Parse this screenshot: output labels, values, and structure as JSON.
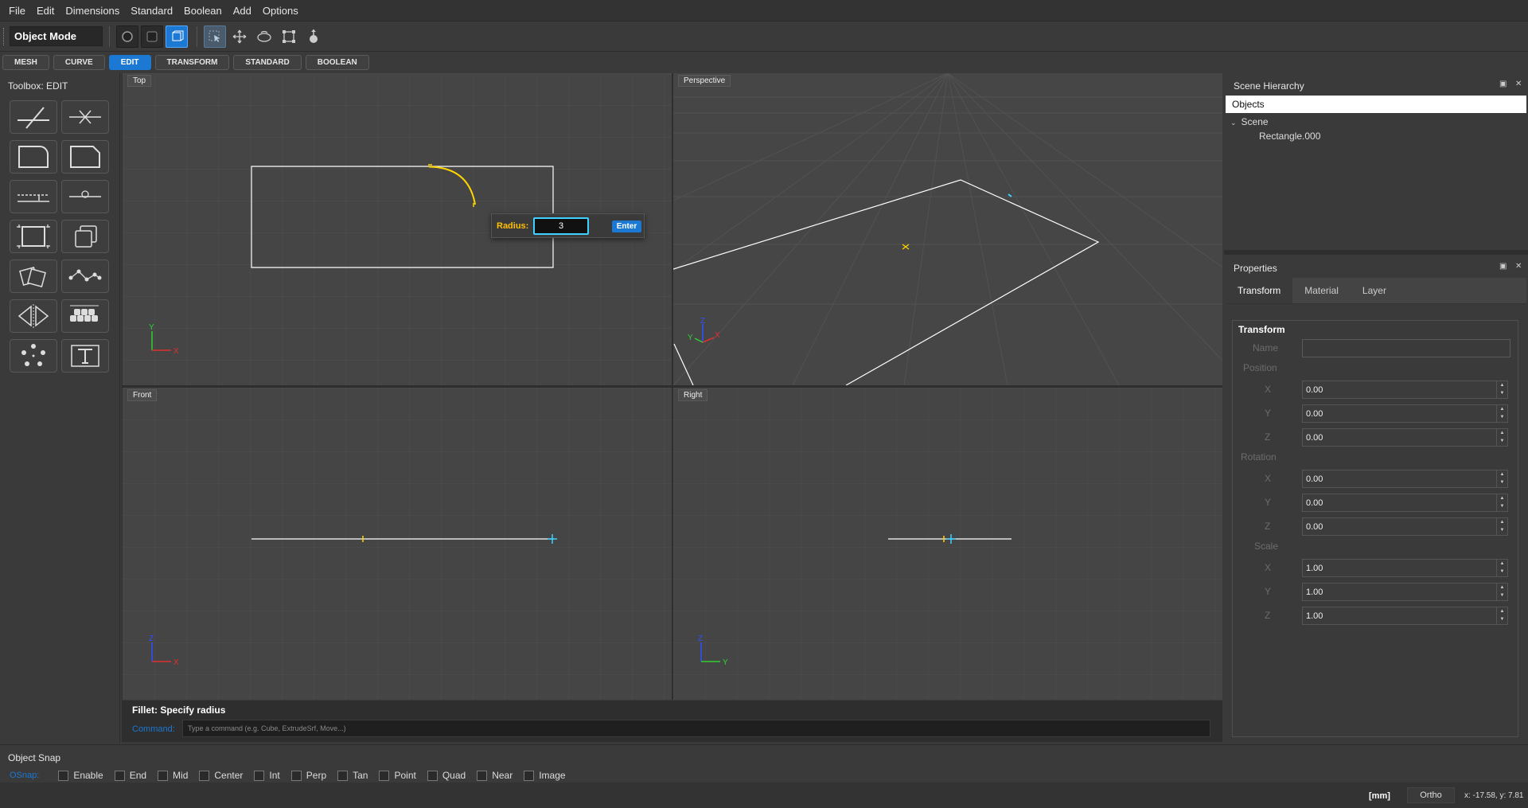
{
  "menu": [
    "File",
    "Edit",
    "Dimensions",
    "Standard",
    "Boolean",
    "Add",
    "Options"
  ],
  "toolbar": {
    "mode": "Object Mode"
  },
  "tabs": [
    "MESH",
    "CURVE",
    "EDIT",
    "TRANSFORM",
    "STANDARD",
    "BOOLEAN"
  ],
  "active_tab": "EDIT",
  "toolbox": {
    "title": "Toolbox: EDIT",
    "tools": [
      "trim",
      "extend",
      "fillet",
      "chamfer",
      "offset",
      "split",
      "bounding-box",
      "copy",
      "rotate-copy",
      "polyline-edit",
      "mirror",
      "array",
      "circular-array",
      "text"
    ]
  },
  "viewports": {
    "top": "Top",
    "perspective": "Perspective",
    "front": "Front",
    "right": "Right"
  },
  "radius_popup": {
    "label": "Radius:",
    "value": "3",
    "button": "Enter"
  },
  "command": {
    "title": "Fillet: Specify radius",
    "label": "Command:",
    "placeholder": "Type a command (e.g. Cube, ExtrudeSrf, Move...)"
  },
  "hierarchy": {
    "title": "Scene Hierarchy",
    "header": "Objects",
    "scene": "Scene",
    "object": "Rectangle.000"
  },
  "properties": {
    "title": "Properties",
    "tabs": [
      "Transform",
      "Material",
      "Layer"
    ],
    "section": "Transform",
    "name_label": "Name",
    "position_label": "Position",
    "rotation_label": "Rotation",
    "scale_label": "Scale",
    "axes": [
      "X",
      "Y",
      "Z"
    ],
    "position": [
      "0.00",
      "0.00",
      "0.00"
    ],
    "rotation": [
      "0.00",
      "0.00",
      "0.00"
    ],
    "scale": [
      "1.00",
      "1.00",
      "1.00"
    ]
  },
  "snap": {
    "title": "Object Snap",
    "label": "OSnap:",
    "options": [
      "Enable",
      "End",
      "Mid",
      "Center",
      "Int",
      "Perp",
      "Tan",
      "Point",
      "Quad",
      "Near",
      "Image"
    ]
  },
  "status": {
    "units": "[mm]",
    "ortho": "Ortho",
    "coords": "x: -17.58, y: 7.81"
  },
  "axis_labels": {
    "x": "X",
    "y": "Y",
    "z": "Z"
  },
  "colors": {
    "accent": "#1b78d3",
    "highlight": "#ffd400",
    "x_axis": "#e03030",
    "y_axis": "#30d030",
    "z_axis": "#3050ff"
  }
}
